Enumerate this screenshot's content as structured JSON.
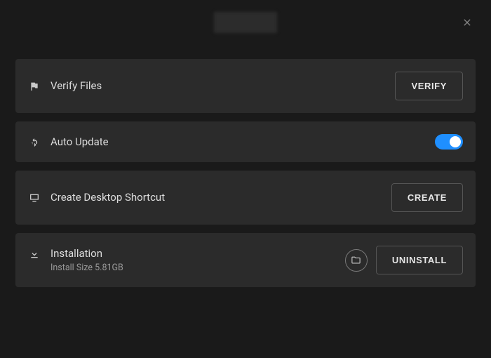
{
  "rows": {
    "verify": {
      "label": "Verify Files",
      "button": "VERIFY"
    },
    "auto_update": {
      "label": "Auto Update",
      "toggle_on": true
    },
    "shortcut": {
      "label": "Create Desktop Shortcut",
      "button": "CREATE"
    },
    "installation": {
      "label": "Installation",
      "sub": "Install Size 5.81GB",
      "button": "UNINSTALL"
    }
  }
}
